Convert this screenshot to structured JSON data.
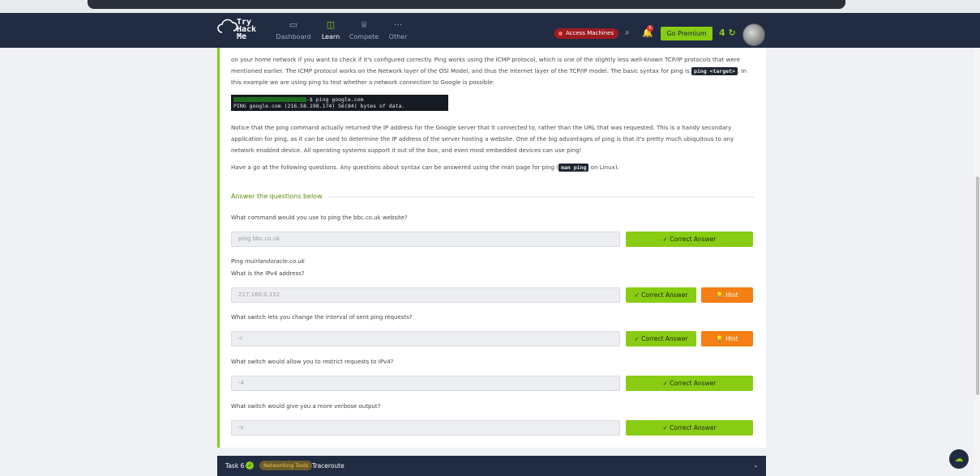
{
  "nav": {
    "logo_line1": "Try",
    "logo_line2": "Hack",
    "logo_line3": "Me",
    "items": [
      {
        "label": "Dashboard",
        "icon": "monitor-icon"
      },
      {
        "label": "Learn",
        "icon": "book-icon"
      },
      {
        "label": "Compete",
        "icon": "trophy-icon"
      },
      {
        "label": "Other",
        "icon": "more-icon"
      }
    ],
    "access_label": "Access Machines",
    "notification_count": "5",
    "premium_label": "Go Premium",
    "streak": "4"
  },
  "body": {
    "para1_a": "on your home network if you want to check if it's configured correctly. Ping works using the ICMP protocol, which is one of the slightly less well-known TCP/IP protocols that were mentioned earlier. The ICMP protocol works on the Network layer of the OSI Model, and thus the Internet layer of the TCP/IP model. The basic syntax for ping is ",
    "para1_code": "ping <target>",
    "para1_b": ". In this example we are using ping to test whether a network connection to Google is possible:",
    "term_line1": "-$ ping google.com",
    "term_line2": "PING google.com (216.58.198.174) 56(84) bytes of data.",
    "para2": "Notice that the ping command actually returned the IP address for the Google server that it connected to, rather than the URL that was requested. This is a handy secondary application for ping, as it can be used to determine the IP address of the server hosting a website. One of the big advantages of ping is that it's pretty much ubiquitous to any network enabled device. All operating systems support it out of the box, and even most embedded devices can use ping!",
    "para3_a": "Have a go at the following questions. Any questions about syntax can be answered using the man page for ping (",
    "para3_code": "man ping",
    "para3_b": " on Linux)."
  },
  "questions_header": "Answer the questions below",
  "questions": [
    {
      "text": "What command would you use to ping the bbc.co.uk website?",
      "answer": "ping bbc.co.uk",
      "button": "✓ Correct Answer"
    },
    {
      "pre": "Ping ",
      "pre_italic": "muirlandoracle.co.uk",
      "text": "What is the IPv4 address?",
      "answer": "217.160.0.152",
      "button": "✓ Correct Answer",
      "hint": "💡 Hint"
    },
    {
      "text": "What switch lets you change the interval of sent ping requests?",
      "answer": "-i",
      "button": "✓ Correct Answer",
      "hint": "💡 Hint"
    },
    {
      "text": "What switch would allow you to restrict requests to IPv4?",
      "answer": "-4",
      "button": "✓ Correct Answer"
    },
    {
      "text": "What switch would give you a more verbose output?",
      "answer": "-v",
      "button": "✓ Correct Answer"
    }
  ],
  "taskbar": {
    "task": "Task 6",
    "tag": "Networking Tools",
    "name": "Traceroute"
  },
  "colors": {
    "accent": "#88cc14",
    "nav": "#212c42",
    "hint": "#f57f14",
    "access": "#9e1b22"
  }
}
